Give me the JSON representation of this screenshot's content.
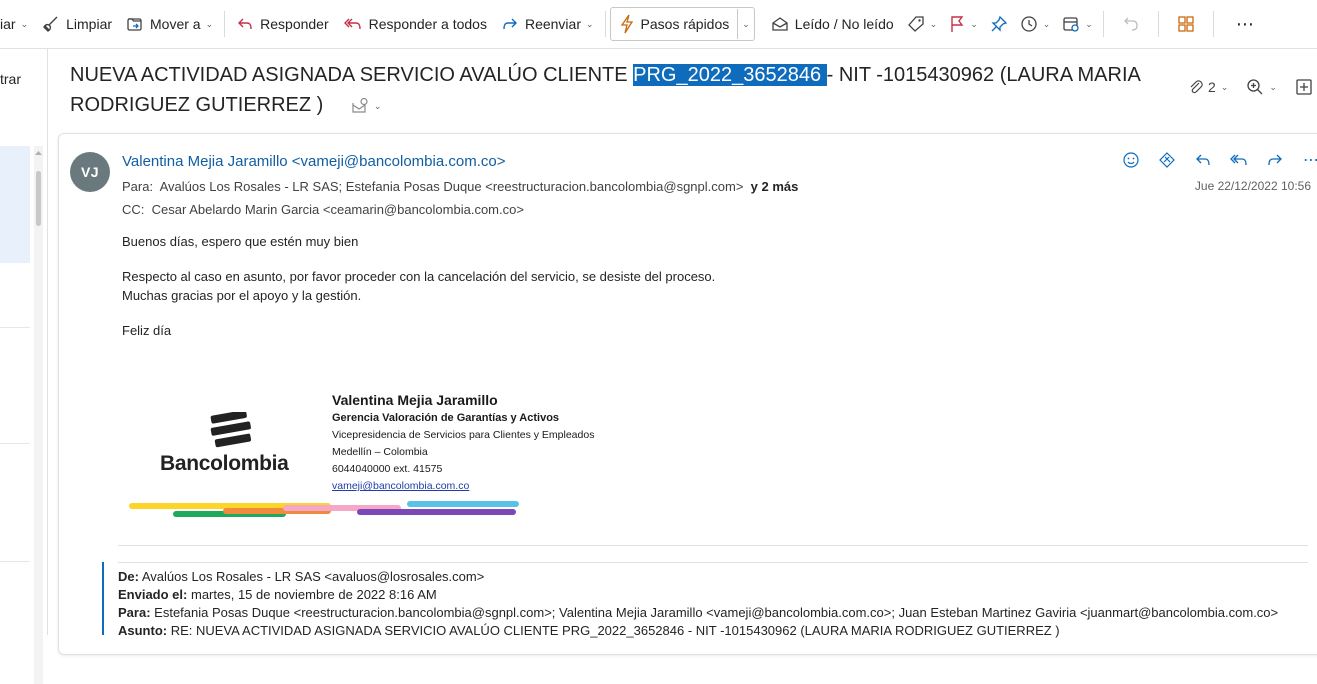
{
  "toolbar": {
    "partial_first": "iar",
    "items": [
      {
        "label": "Limpiar",
        "icon": "broom-icon"
      },
      {
        "label": "Mover a",
        "icon": "move-folder-icon"
      },
      {
        "label": "Responder",
        "icon": "reply-icon"
      },
      {
        "label": "Responder a todos",
        "icon": "reply-all-icon"
      },
      {
        "label": "Reenviar",
        "icon": "forward-icon"
      },
      {
        "label": "Pasos rápidos",
        "icon": "lightning-icon"
      },
      {
        "label": "Leído / No leído",
        "icon": "envelope-open-icon"
      }
    ],
    "accent": "#0f6cbd",
    "flag_color": "#c4314b",
    "apps_color": "#c8690f"
  },
  "left_panel": {
    "filter_label": "trar"
  },
  "subject": {
    "before": "NUEVA ACTIVIDAD ASIGNADA SERVICIO AVALÚO CLIENTE ",
    "highlight": "PRG_2022_3652846 ",
    "after": "- NIT -1015430962 (LAURA MARIA RODRIGUEZ GUTIERREZ )",
    "attachment_count": "2"
  },
  "message": {
    "avatar_initials": "VJ",
    "avatar_color": "#69797e",
    "sender": "Valentina Mejia Jaramillo <vameji@bancolombia.com.co>",
    "to_label": "Para:",
    "to_value": "Avalúos Los Rosales - LR SAS;  Estefania Posas Duque <reestructuracion.bancolombia@sgnpl.com>",
    "to_more": "y 2 más",
    "cc_label": "CC:",
    "cc_value": "Cesar Abelardo Marin Garcia <ceamarin@bancolombia.com.co>",
    "date": "Jue 22/12/2022 10:56",
    "body": {
      "greeting": "Buenos días, espero que estén muy bien",
      "line1": "Respecto al caso en asunto, por favor proceder con la cancelación del servicio, se desiste del proceso.",
      "line2": "Muchas gracias por el apoyo y la gestión.",
      "closing": "Feliz día"
    }
  },
  "signature": {
    "brand": "Bancolombia",
    "name": "Valentina Mejia Jaramillo",
    "dept": "Gerencia Valoración de Garantías y Activos",
    "vp": "Vicepresidencia de Servicios para Clientes y Empleados",
    "city": "Medellín – Colombia",
    "phone": "6044040000 ext. 41575",
    "email": "vameji@bancolombia.com.co",
    "stripe_colors": [
      "#fdd42a",
      "#1ea95d",
      "#f08a3e",
      "#f5a8c6",
      "#7a48b7",
      "#5bc2e7"
    ]
  },
  "quoted": {
    "from_label": "De:",
    "from_value": "Avalúos Los Rosales - LR SAS <avaluos@losrosales.com>",
    "sent_label": "Enviado el:",
    "sent_value": "martes, 15 de noviembre de 2022 8:16 AM",
    "to_label": "Para:",
    "to_value": "Estefania Posas Duque <reestructuracion.bancolombia@sgnpl.com>; Valentina Mejia Jaramillo <vameji@bancolombia.com.co>; Juan Esteban Martinez Gaviria <juanmart@bancolombia.com.co>",
    "subject_label": "Asunto:",
    "subject_value": "RE: NUEVA ACTIVIDAD ASIGNADA SERVICIO AVALÚO CLIENTE PRG_2022_3652846 - NIT -1015430962 (LAURA MARIA RODRIGUEZ GUTIERREZ )"
  }
}
